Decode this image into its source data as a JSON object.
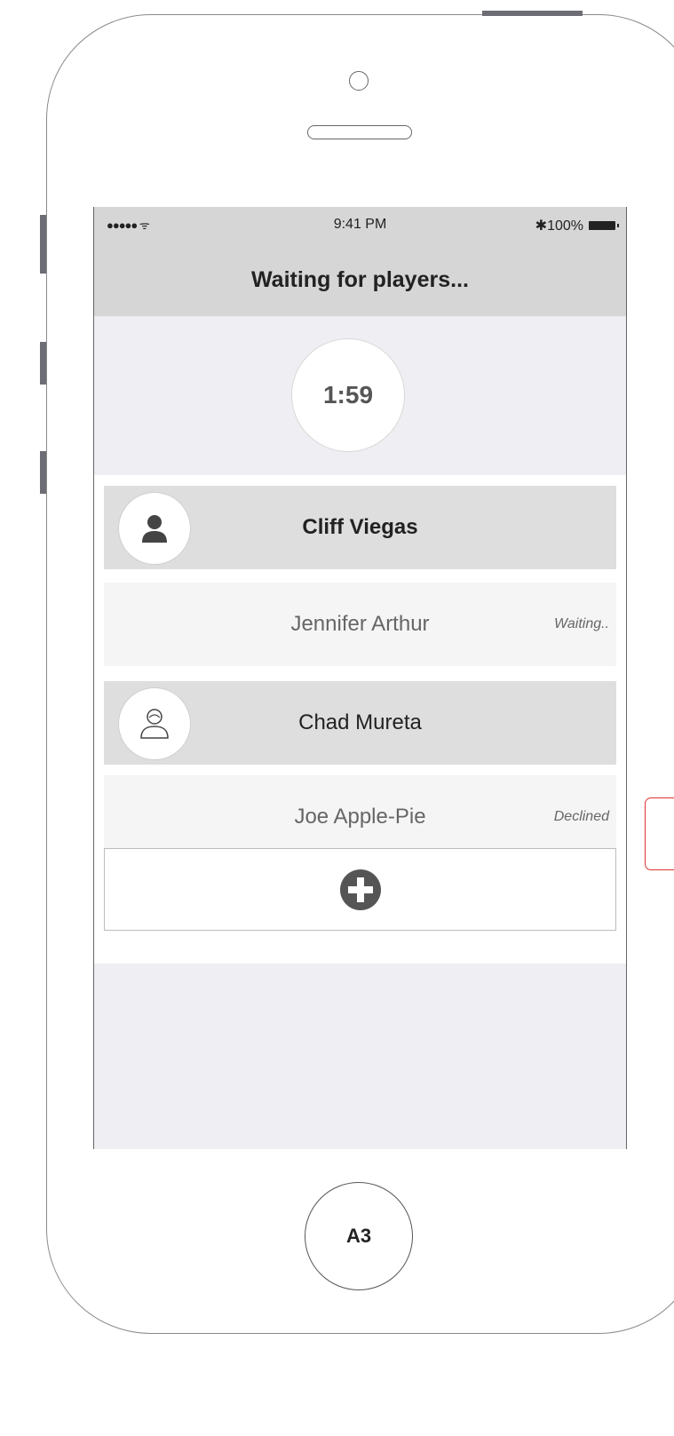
{
  "status_bar": {
    "signal": "●●●●● ᯤ",
    "time": "9:41 PM",
    "battery": "✱100%"
  },
  "header": {
    "title": "Waiting for players..."
  },
  "timer": {
    "value": "1:59"
  },
  "players": [
    {
      "name": "Cliff Viegas",
      "status": "",
      "avatar": "person-filled-icon"
    },
    {
      "name": "Jennifer Arthur",
      "status": "Waiting..",
      "avatar": ""
    },
    {
      "name": "Chad Mureta",
      "status": "",
      "avatar": "person-outline-icon"
    },
    {
      "name": "Joe Apple-Pie",
      "status": "Declined",
      "avatar": ""
    }
  ],
  "add_button": {
    "icon": "plus-circle-icon"
  },
  "home_button": {
    "label": "A3"
  }
}
